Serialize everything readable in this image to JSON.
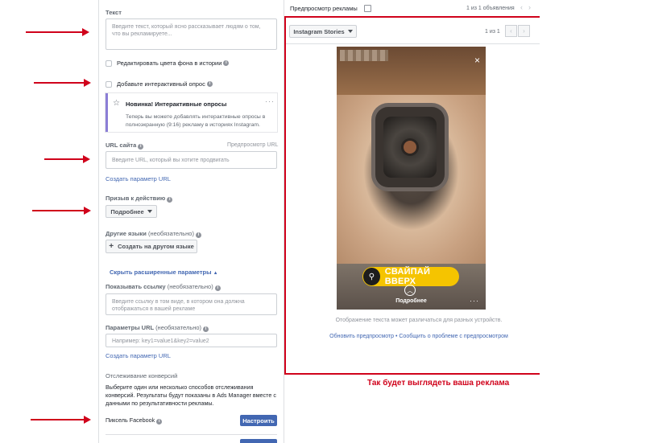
{
  "editor": {
    "text_label": "Текст",
    "text_placeholder": "Введите текст, который ясно рассказывает людям о том, что вы рекламируете...",
    "checkbox_bg_label": "Редактировать цвета фона в истории",
    "checkbox_poll_label": "Добавьте интерактивный опрос",
    "new_card": {
      "title": "Новинка! Интерактивные опросы",
      "text": "Теперь вы можете добавлять интерактивные опросы в полноэкранную (9:16) рекламу в историях Instagram."
    },
    "url_label": "URL сайта",
    "url_preview_link": "Предпросмотр URL",
    "url_placeholder": "Введите URL, который вы хотите продвигать",
    "create_url_param": "Создать параметр URL",
    "cta_label": "Призыв к действию",
    "cta_value": "Подробнее",
    "other_lang_label": "Другие языки",
    "optional": "(необязательно)",
    "create_lang_button": "Создать на другом языке",
    "hide_advanced": "Скрыть расширенные параметры",
    "display_link_label": "Показывать ссылку",
    "display_link_placeholder": "Введите ссылку в том виде, в котором она должна отображаться в вашей рекламе",
    "url_params_label": "Параметры URL",
    "url_params_placeholder": "Например: key1=value1&key2=value2",
    "create_url_param_2": "Создать параметр URL",
    "conversion_head": "Отслеживание конверсий",
    "conversion_text": "Выберите один или несколько способов отслеживания конверсий. Результаты будут показаны в Ads Manager вместе с данными по результативности рекламы.",
    "pixel_label": "Пиксель Facebook",
    "configure_button": "Настроить"
  },
  "preview": {
    "title": "Предпросмотр рекламы",
    "pager": "1 из 1 объявления",
    "placement": "Instagram Stories",
    "count": "1 из 1",
    "swipe_text": "СВАЙПАЙ ВВЕРХ",
    "more_label": "Подробнее",
    "note": "Отображение текста может различаться для разных устройств.",
    "refresh_link": "Обновить предпросмотр",
    "separator": " • ",
    "report_link": "Сообщить о проблеме с предпросмотром"
  },
  "caption": "Так будет выглядеть ваша реклама",
  "colors": {
    "accent": "#4267b2",
    "annotation_red": "#d0021b",
    "swipe_yellow": "#f5c400"
  }
}
